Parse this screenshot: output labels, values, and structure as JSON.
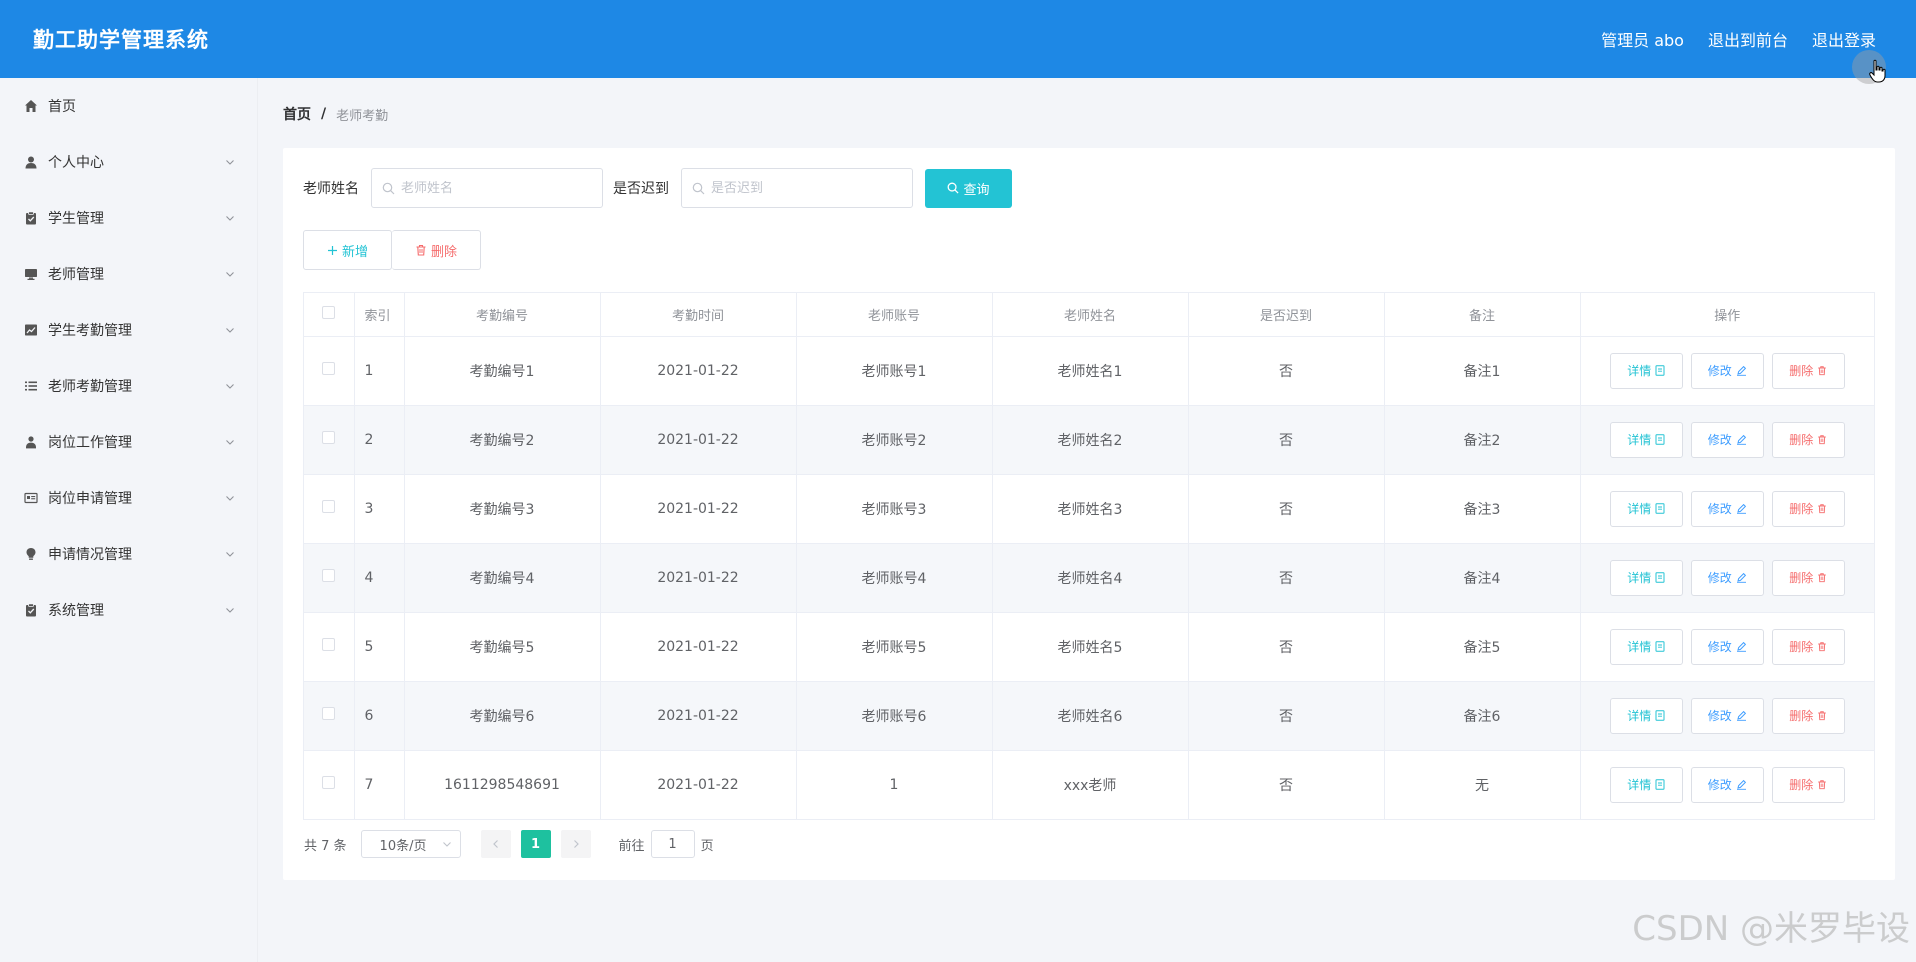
{
  "header": {
    "title": "勤工助学管理系统",
    "admin_label": "管理员 abo",
    "front_label": "退出到前台",
    "logout_label": "退出登录"
  },
  "sidebar": {
    "items": [
      {
        "label": "首页",
        "icon": "home-icon",
        "has_arrow": false
      },
      {
        "label": "个人中心",
        "icon": "user-icon",
        "has_arrow": true
      },
      {
        "label": "学生管理",
        "icon": "clipboard-icon",
        "has_arrow": true
      },
      {
        "label": "老师管理",
        "icon": "monitor-icon",
        "has_arrow": true
      },
      {
        "label": "学生考勤管理",
        "icon": "chart-icon",
        "has_arrow": true
      },
      {
        "label": "老师考勤管理",
        "icon": "list-icon",
        "has_arrow": true
      },
      {
        "label": "岗位工作管理",
        "icon": "person-icon",
        "has_arrow": true
      },
      {
        "label": "岗位申请管理",
        "icon": "card-icon",
        "has_arrow": true
      },
      {
        "label": "申请情况管理",
        "icon": "bulb-icon",
        "has_arrow": true
      },
      {
        "label": "系统管理",
        "icon": "clipboard-icon",
        "has_arrow": true
      }
    ]
  },
  "breadcrumb": {
    "home": "首页",
    "separator": "/",
    "current": "老师考勤"
  },
  "search": {
    "name_label": "老师姓名",
    "name_placeholder": "老师姓名",
    "late_label": "是否迟到",
    "late_placeholder": "是否迟到",
    "query_label": "查询"
  },
  "actions": {
    "add_label": "新增",
    "delete_label": "删除"
  },
  "table": {
    "columns": [
      "索引",
      "考勤编号",
      "考勤时间",
      "老师账号",
      "老师姓名",
      "是否迟到",
      "备注",
      "操作"
    ],
    "rows": [
      [
        "1",
        "考勤编号1",
        "2021-01-22",
        "老师账号1",
        "老师姓名1",
        "否",
        "备注1"
      ],
      [
        "2",
        "考勤编号2",
        "2021-01-22",
        "老师账号2",
        "老师姓名2",
        "否",
        "备注2"
      ],
      [
        "3",
        "考勤编号3",
        "2021-01-22",
        "老师账号3",
        "老师姓名3",
        "否",
        "备注3"
      ],
      [
        "4",
        "考勤编号4",
        "2021-01-22",
        "老师账号4",
        "老师姓名4",
        "否",
        "备注4"
      ],
      [
        "5",
        "考勤编号5",
        "2021-01-22",
        "老师账号5",
        "老师姓名5",
        "否",
        "备注5"
      ],
      [
        "6",
        "考勤编号6",
        "2021-01-22",
        "老师账号6",
        "老师姓名6",
        "否",
        "备注6"
      ],
      [
        "7",
        "1611298548691",
        "2021-01-22",
        "1",
        "xxx老师",
        "否",
        "无"
      ]
    ],
    "op_detail": "详情",
    "op_edit": "修改",
    "op_delete": "删除"
  },
  "pager": {
    "total": "共 7 条",
    "page_size": "10条/页",
    "current_page": "1",
    "goto_label": "前往",
    "goto_value": "1",
    "page_suffix": "页"
  },
  "watermark": "CSDN @米罗毕设",
  "colors": {
    "header": "#1e88e5",
    "accent": "#23c3d4",
    "danger": "#f56c6c",
    "pager_active": "#1ec19f"
  }
}
